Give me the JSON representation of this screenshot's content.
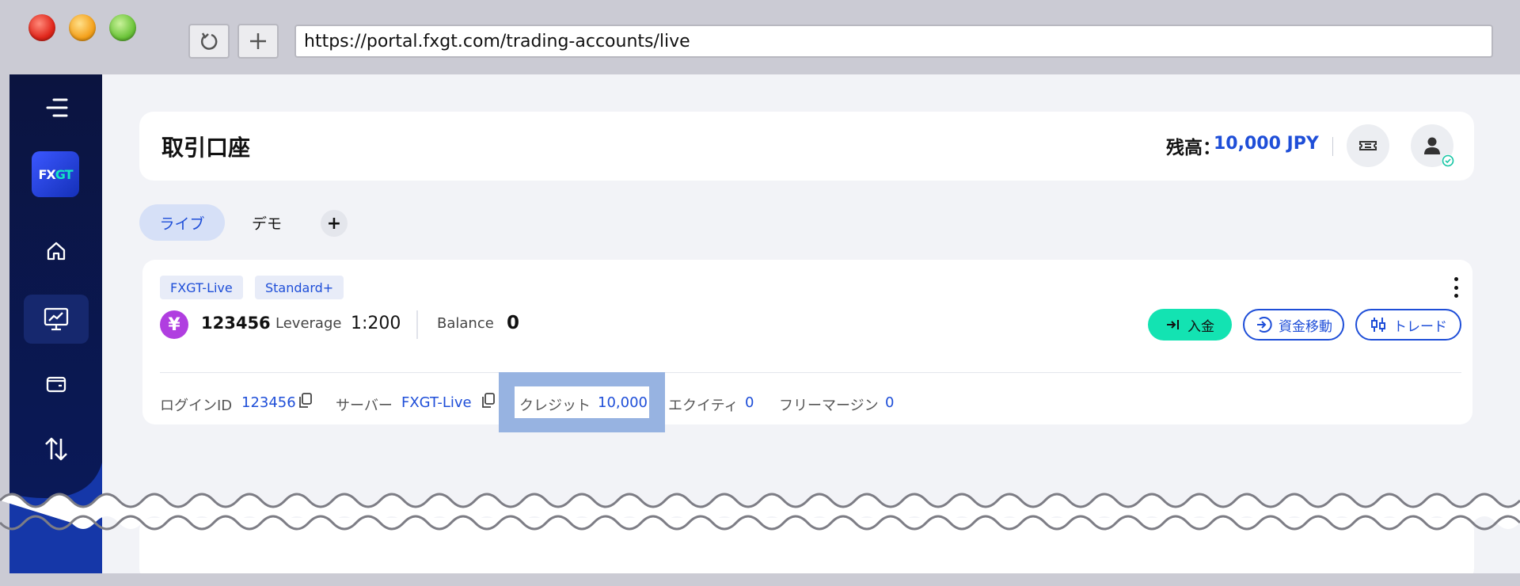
{
  "browser": {
    "url": "https://portal.fxgt.com/trading-accounts/live",
    "reload_icon": "reload-icon",
    "newtab_icon": "plus-icon"
  },
  "sidebar": {
    "logo": {
      "fx": "FX",
      "gt": "GT"
    },
    "items": [
      {
        "icon": "home-icon"
      },
      {
        "icon": "chart-monitor-icon",
        "active": true
      },
      {
        "icon": "wallet-icon"
      },
      {
        "icon": "transfer-arrows-icon"
      }
    ]
  },
  "header": {
    "title": "取引口座",
    "balance_label": "残高：",
    "balance_value": "10,000 JPY"
  },
  "tabs": [
    {
      "label": "ライブ",
      "active": true
    },
    {
      "label": "デモ",
      "active": false
    }
  ],
  "add_tab_label": "+",
  "account": {
    "tags": [
      "FXGT-Live",
      "Standard+"
    ],
    "currency_symbol": "¥",
    "number": "123456",
    "leverage_label": "Leverage",
    "leverage_value": "1:200",
    "balance_label": "Balance",
    "balance_value": "0",
    "buttons": {
      "deposit": "入金",
      "transfer": "資金移動",
      "trade": "トレード"
    },
    "details": {
      "login_label": "ログインID",
      "login_value": "123456",
      "server_label": "サーバー",
      "server_value": "FXGT-Live",
      "credit_label": "クレジット",
      "credit_value": "10,000",
      "equity_label": "エクイティ",
      "equity_value": "0",
      "free_margin_label": "フリーマージン",
      "free_margin_value": "0"
    }
  },
  "colors": {
    "accent": "#1e4ed8",
    "deposit": "#13e3b2",
    "sidebar": "#0b1440",
    "highlight": "#97b3e1"
  }
}
